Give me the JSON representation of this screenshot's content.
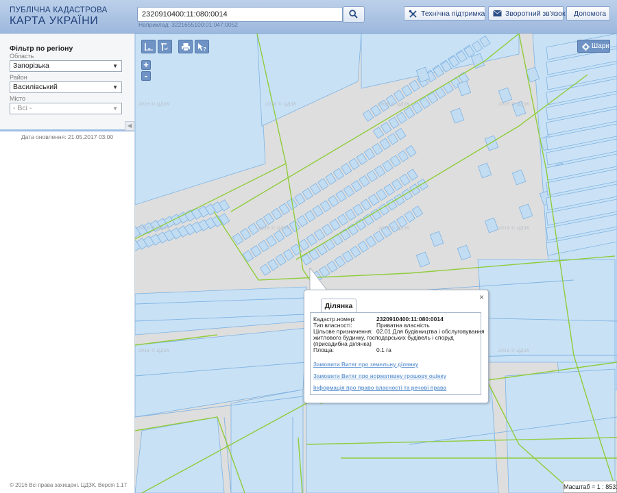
{
  "header": {
    "brand_top": "ПУБЛІЧНА КАДАСТРОВА",
    "brand_main": "КАРТА УКРАЇНИ",
    "search_value": "2320910400:11:080:0014",
    "search_example": "Наприклад: 3221655100:01:047:0052",
    "buttons": {
      "support": "Технічна підтримка",
      "feedback": "Зворотний зв'язок",
      "help": "Допомога"
    }
  },
  "sidebar": {
    "filter_title": "Фільтр по регіону",
    "region_label": "Область",
    "region_value": "Запорізька",
    "district_label": "Район",
    "district_value": "Василівський",
    "city_label": "Місто",
    "city_value": "- Всі -",
    "update_date": "Дата оновлення: 21.05.2017 03:00",
    "copyright": "© 2016 Всі права захищені. ЦДЗК. Версія 1.17"
  },
  "map": {
    "layers_label": "Шари",
    "zoom_in": "+",
    "zoom_out": "-",
    "scale": "Масштаб = 1 : 8531",
    "watermark": "2016 © ЦДЗК"
  },
  "popup": {
    "tab": "Ділянка",
    "close": "×",
    "rows": {
      "cadastral_key": "Кадастр.номер:",
      "cadastral_val": "2320910400:11:080:0014",
      "ownership_key": "Тип власності:",
      "ownership_val": "Приватна власність",
      "purpose_key": "Цільове призначення:",
      "purpose_val": "02.01 Для будівництва і обслуговування",
      "purpose_cont": "житлового будинку, господарських будівель і споруд",
      "purpose_cont2": "(присадибна ділянка)",
      "area_key": "Площа:",
      "area_val": "0.1 га"
    },
    "links": {
      "extract_land": "Замовити Витяг про земельну ділянку",
      "extract_valuation": "Замовити Витяг про нормативну грошову оцінку",
      "ownership_info": "Інформація про право власності та речові права"
    }
  },
  "colors": {
    "parcel_fill": "#c2dcf2",
    "parcel_stroke": "#7fb3e2",
    "boundary": "#8fcc3a",
    "map_bg": "#dedede",
    "header": "#a9c1e3"
  }
}
